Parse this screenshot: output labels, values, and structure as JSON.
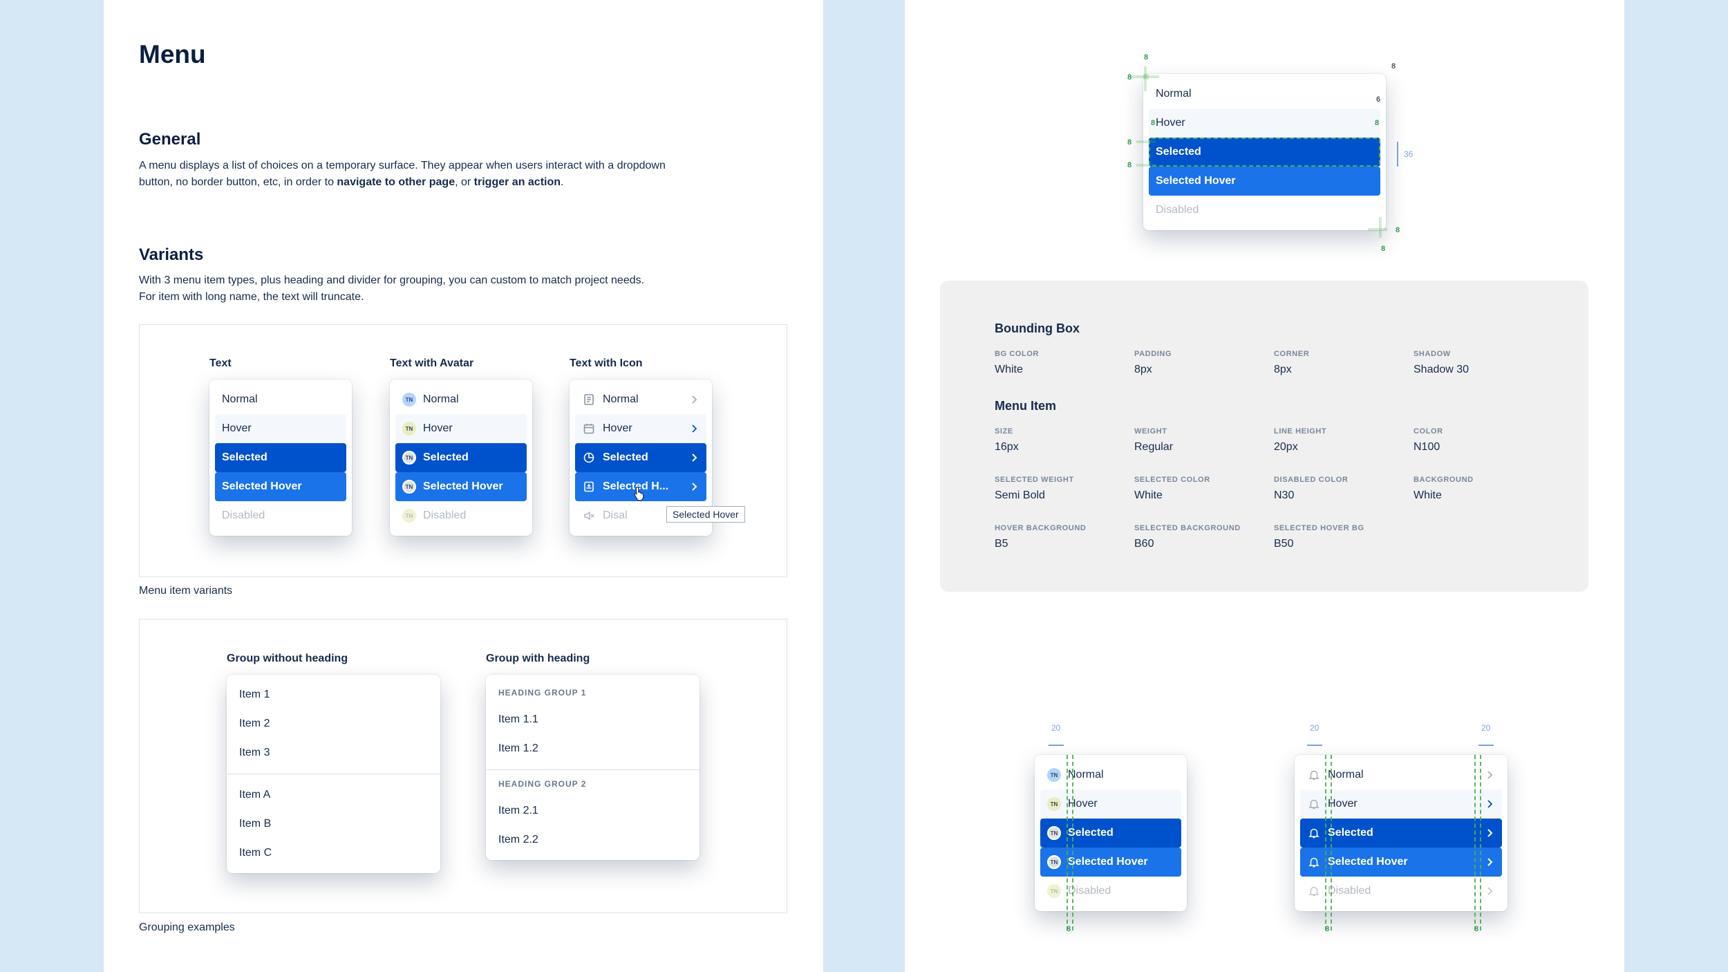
{
  "title": "Menu",
  "general": {
    "heading": "General",
    "text_1": "A menu displays a list of choices on a temporary surface. They appear when users interact with a dropdown button, no border button, etc, in order to ",
    "bold_1": "navigate to other page",
    "text_2": ", or ",
    "bold_2": "trigger an action",
    "text_3": "."
  },
  "variants": {
    "heading": "Variants",
    "line_1": "With 3 menu item types, plus heading and divider for grouping, you can custom to match project needs.",
    "line_2": "For item with long name, the text will truncate.",
    "columns": [
      {
        "label": "Text"
      },
      {
        "label": "Text with Avatar"
      },
      {
        "label": "Text with Icon"
      }
    ],
    "items": [
      "Normal",
      "Hover",
      "Selected",
      "Selected Hover",
      "Disabled"
    ],
    "truncated_item": "Selected H...",
    "truncated_disabled": "Disal",
    "avatar_initials": "TN",
    "tooltip": "Selected Hover",
    "caption": "Menu item variants"
  },
  "grouping": {
    "without_heading_label": "Group without heading",
    "with_heading_label": "Group with heading",
    "group_a": [
      "Item 1",
      "Item 2",
      "Item 3"
    ],
    "group_b": [
      "Item A",
      "Item B",
      "Item C"
    ],
    "heading_1": "HEADING GROUP 1",
    "heading_1_items": [
      "Item 1.1",
      "Item 1.2"
    ],
    "heading_2": "HEADING GROUP 2",
    "heading_2_items": [
      "Item 2.1",
      "Item 2.2"
    ],
    "caption": "Grouping examples"
  },
  "spec": {
    "bounding_box": {
      "heading": "Bounding Box",
      "fields": [
        {
          "key": "BG COLOR",
          "value": "White"
        },
        {
          "key": "PADDING",
          "value": "8px"
        },
        {
          "key": "CORNER",
          "value": "8px"
        },
        {
          "key": "SHADOW",
          "value": "Shadow 30"
        }
      ]
    },
    "menu_item": {
      "heading": "Menu Item",
      "fields": [
        {
          "key": "SIZE",
          "value": "16px"
        },
        {
          "key": "WEIGHT",
          "value": "Regular"
        },
        {
          "key": "LINE HEIGHT",
          "value": "20px"
        },
        {
          "key": "COLOR",
          "value": "N100"
        },
        {
          "key": "SELECTED WEIGHT",
          "value": "Semi Bold"
        },
        {
          "key": "SELECTED COLOR",
          "value": "White"
        },
        {
          "key": "DISABLED COLOR",
          "value": "N30"
        },
        {
          "key": "BACKGROUND",
          "value": "White"
        },
        {
          "key": "HOVER BACKGROUND",
          "value": "B5"
        },
        {
          "key": "SELECTED BACKGROUND",
          "value": "B60"
        },
        {
          "key": "SELECTED HOVER BG",
          "value": "B50"
        }
      ]
    }
  },
  "measurements": {
    "eight": "8",
    "six": "6",
    "thirty_six": "36",
    "twenty": "20"
  },
  "colors": {
    "selected": "#0052cc",
    "selected_hover": "#1a73e8",
    "hover": "#f4f8fd",
    "disabled": "#b3b9c4",
    "spec_bg": "#f0f0f0",
    "page_bg": "#d6e7f5"
  }
}
